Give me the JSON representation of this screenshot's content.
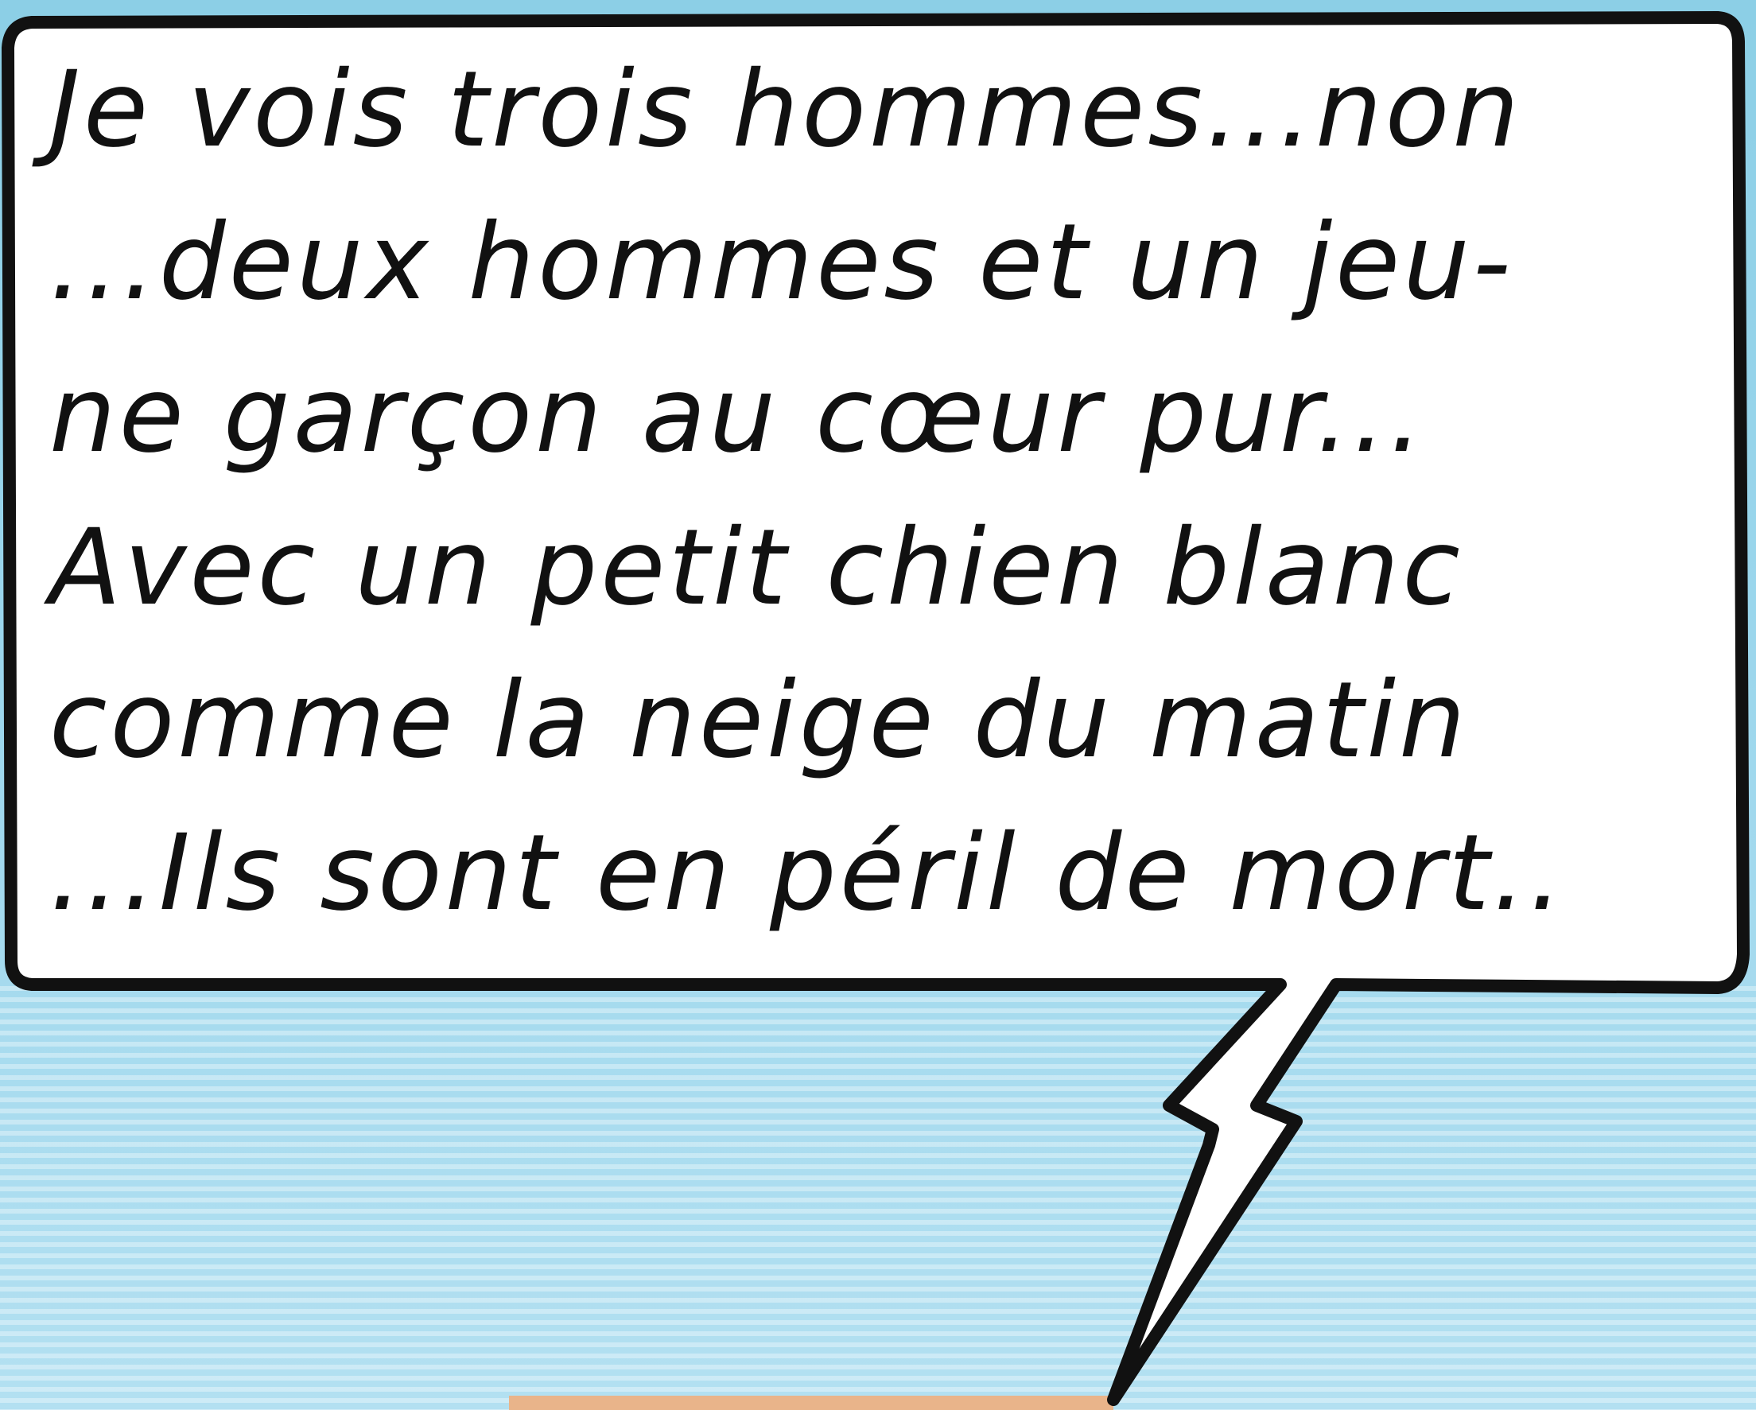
{
  "panel": {
    "background_color": "#9bd6ec",
    "bubble_fill": "#ffffff",
    "bubble_stroke": "#111111",
    "text_color": "#111111"
  },
  "speech_bubble": {
    "lines": [
      "Je vois trois hommes...non",
      "...deux hommes et un jeu-",
      "ne garçon au cœur pur...",
      "Avec un petit chien blanc",
      "comme la neige du matin",
      "...Ils sont en péril de mort.."
    ]
  }
}
